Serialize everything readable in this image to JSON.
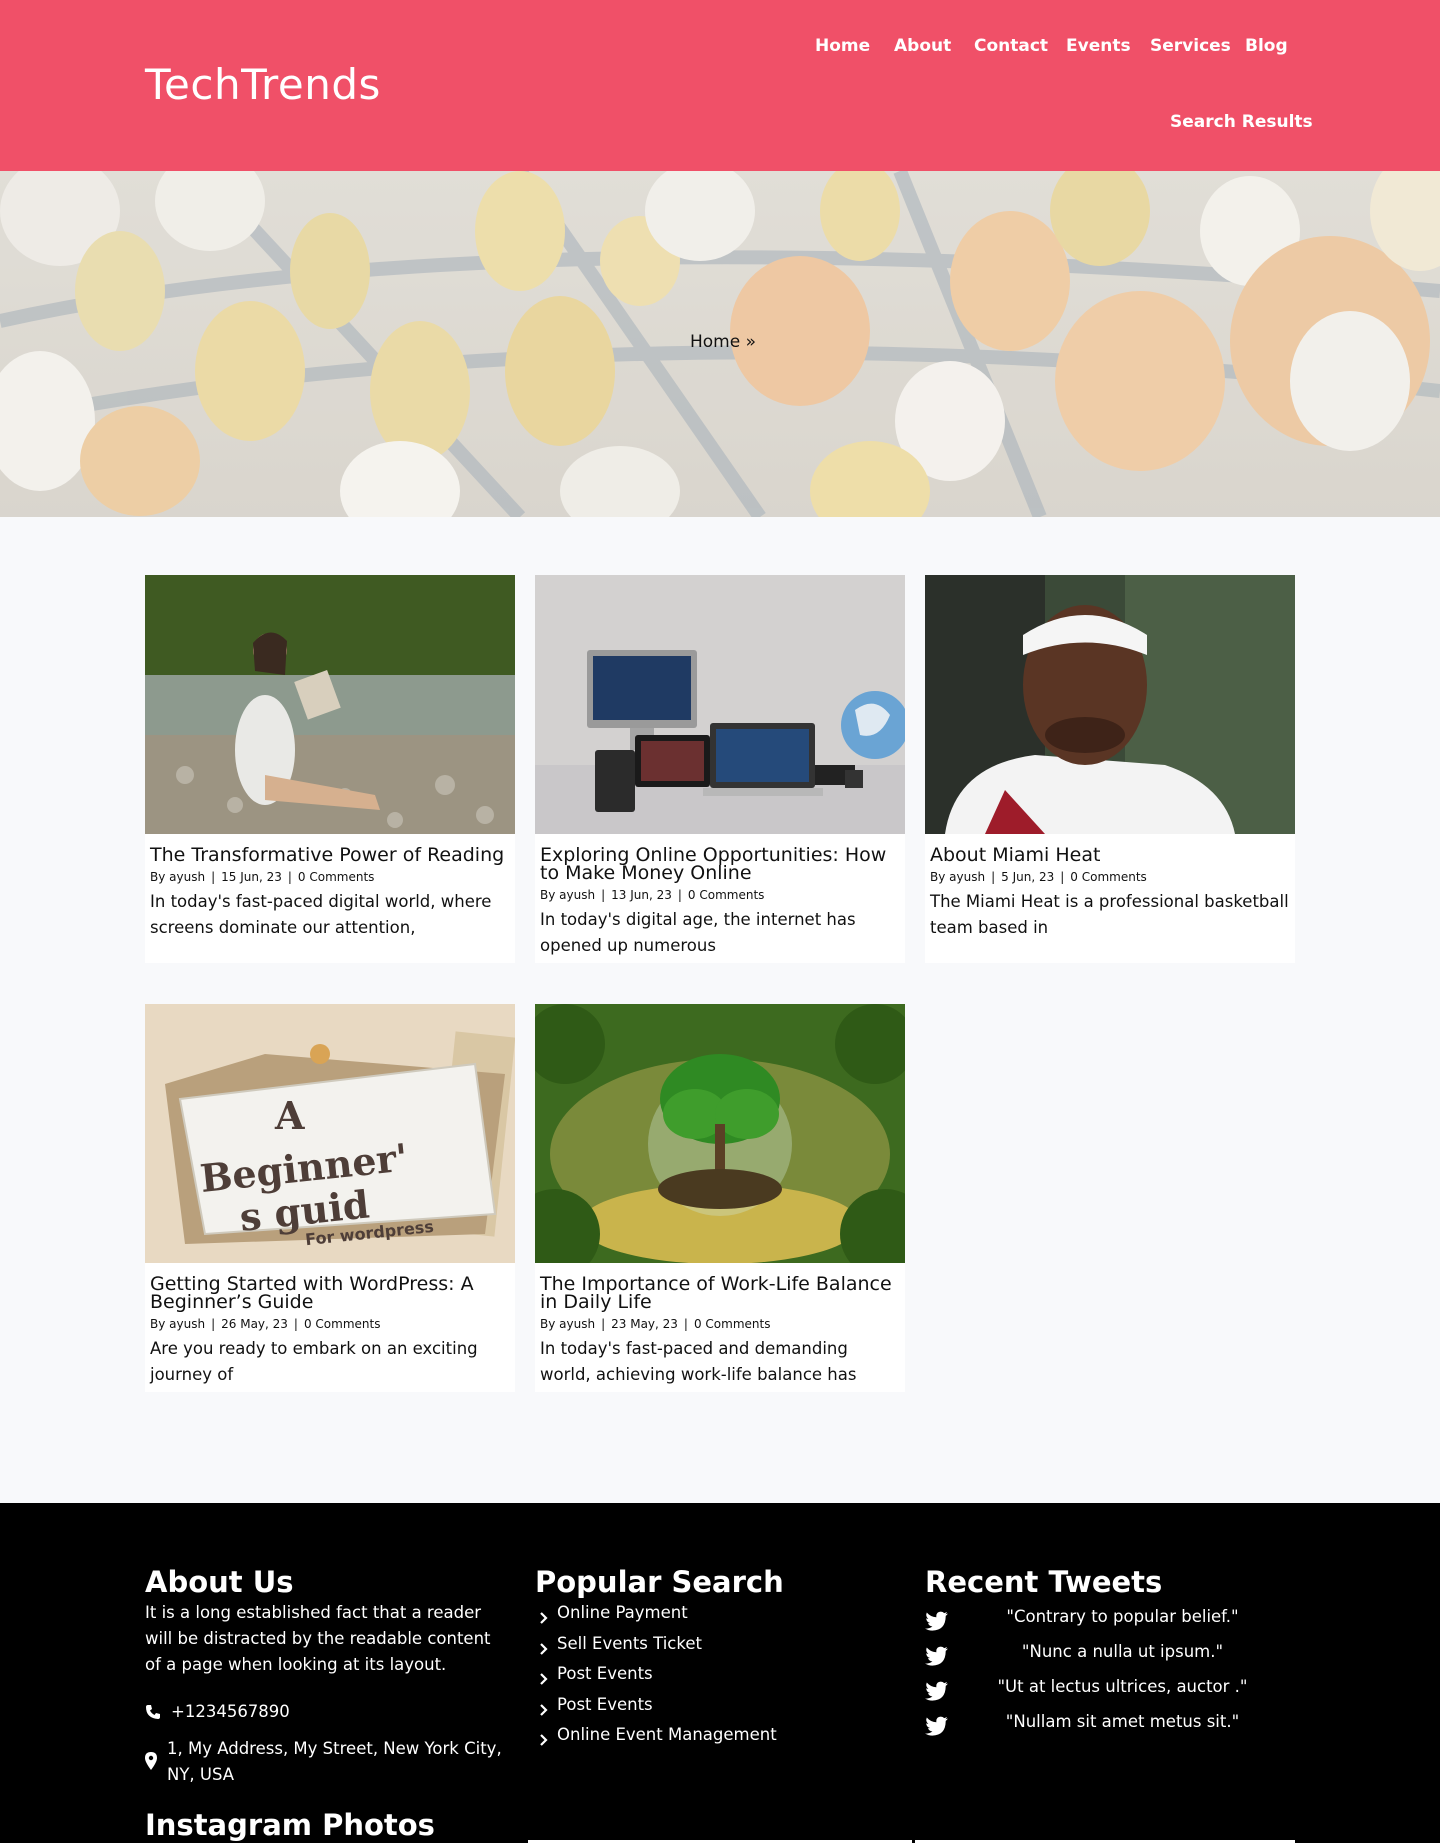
{
  "site": {
    "logo": "TechTrends"
  },
  "nav": {
    "items": [
      {
        "label": "Home"
      },
      {
        "label": "About"
      },
      {
        "label": "Contact"
      },
      {
        "label": "Events"
      },
      {
        "label": "Services"
      },
      {
        "label": "Blog"
      },
      {
        "label": "Search Results"
      }
    ]
  },
  "hero": {
    "breadcrumb": "Home »"
  },
  "posts": [
    {
      "title": "The Transformative Power of Reading",
      "author": "By ayush",
      "date": "15 Jun, 23",
      "comments": "0 Comments",
      "excerpt": "In today's fast-paced digital world, where screens dominate our attention,"
    },
    {
      "title": "Exploring Online Opportunities: How to Make Money Online",
      "author": "By ayush",
      "date": "13 Jun, 23",
      "comments": "0 Comments",
      "excerpt": "In today's digital age, the internet has opened up numerous"
    },
    {
      "title": "About Miami Heat",
      "author": "By ayush",
      "date": "5 Jun, 23",
      "comments": "0 Comments",
      "excerpt": "The Miami Heat is a professional basketball team based in"
    },
    {
      "title": "Getting Started with WordPress: A Beginner’s Guide",
      "author": "By ayush",
      "date": "26 May, 23",
      "comments": "0 Comments",
      "excerpt": "Are you ready to embark on an exciting journey of",
      "image_text": [
        "A",
        "Beginner'",
        "s guid",
        "For wordpress"
      ]
    },
    {
      "title": "The Importance of Work-Life Balance in Daily Life",
      "author": "By ayush",
      "date": "23 May, 23",
      "comments": "0 Comments",
      "excerpt": "In today's fast-paced and demanding world, achieving work-life balance has"
    }
  ],
  "footer": {
    "about": {
      "heading": "About Us",
      "text": "It is a long established fact that a reader will be distracted by the readable content of a page when looking at its layout.",
      "phone": "+1234567890",
      "address": "1, My Address, My Street, New York City, NY, USA"
    },
    "popular": {
      "heading": "Popular Search",
      "items": [
        "Online Payment",
        "Sell Events Ticket",
        "Post Events",
        "Post Events",
        "Online Event Management"
      ]
    },
    "tweets": {
      "heading": "Recent Tweets",
      "items": [
        "\"Contrary to popular belief.\"",
        "\"Nunc a nulla ut ipsum.\"",
        "\"Ut at lectus ultrices, auctor .\"",
        "\"Nullam sit amet metus sit.\""
      ]
    },
    "instagram": {
      "heading": "Instagram Photos"
    }
  },
  "colors": {
    "header": "#f05068",
    "footer": "#000000",
    "page_bg": "#f8f9fb"
  },
  "icons": [
    "phone-icon",
    "map-pin-icon",
    "chevron-right-icon",
    "twitter-icon"
  ]
}
